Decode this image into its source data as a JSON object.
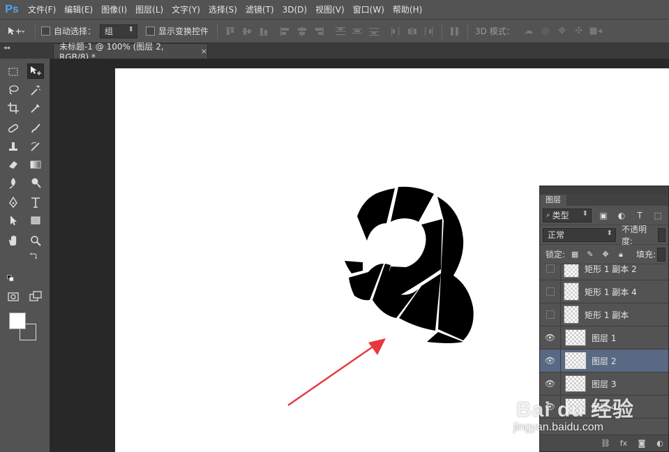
{
  "app": {
    "logo": "Ps"
  },
  "menu": [
    "文件(F)",
    "编辑(E)",
    "图像(I)",
    "图层(L)",
    "文字(Y)",
    "选择(S)",
    "滤镜(T)",
    "3D(D)",
    "视图(V)",
    "窗口(W)",
    "帮助(H)"
  ],
  "options_bar": {
    "auto_select_label": "自动选择：",
    "auto_select_value": "组",
    "show_transform_label": "显示变换控件",
    "mode_3d_label": "3D 模式："
  },
  "document_tab": {
    "title": "未标题-1 @ 100% (图层 2, RGB/8) *",
    "close": "×"
  },
  "canvas": {
    "digit": "3",
    "arrow_color": "#e8383d"
  },
  "layers_panel": {
    "tab": "图层",
    "filter_value": "类型",
    "blend_mode": "正常",
    "opacity_label": "不透明度:",
    "lock_label": "锁定:",
    "fill_label": "填充:",
    "layers": [
      {
        "name": "矩形 1 副本 2",
        "visible": false,
        "selected": false
      },
      {
        "name": "矩形 1 副本 4",
        "visible": false,
        "selected": false
      },
      {
        "name": "矩形 1 副本",
        "visible": false,
        "selected": false
      },
      {
        "name": "图层 1",
        "visible": true,
        "selected": false
      },
      {
        "name": "图层 2",
        "visible": true,
        "selected": true
      },
      {
        "name": "图层 3",
        "visible": true,
        "selected": false
      },
      {
        "name": "图层 4",
        "visible": true,
        "selected": false
      }
    ]
  },
  "watermark": {
    "brand": "Bai du 经验",
    "url": "jingyan.baidu.com"
  }
}
